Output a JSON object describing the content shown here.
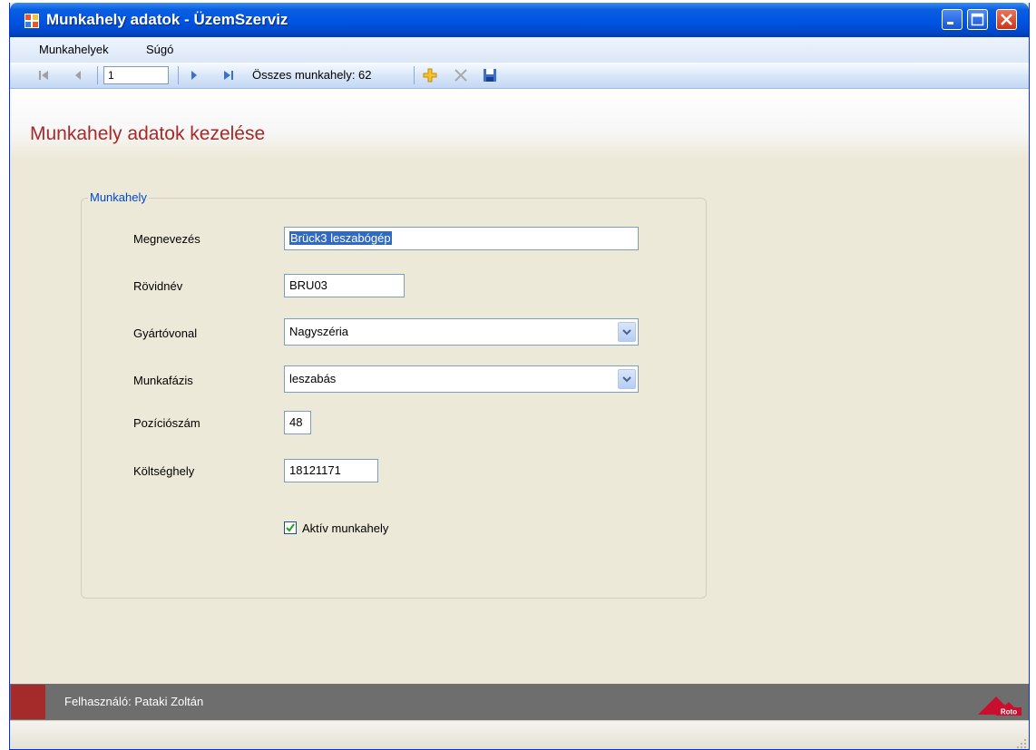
{
  "window": {
    "title": "Munkahely adatok - ÜzemSzerviz"
  },
  "menu": [
    {
      "label": "Munkahelyek"
    },
    {
      "label": "Súgó"
    }
  ],
  "toolbar": {
    "position_value": "1",
    "total_label": "Összes munkahely: 62",
    "icons": [
      "first-record-icon",
      "previous-record-icon",
      "next-record-icon",
      "last-record-icon",
      "add-icon",
      "delete-icon",
      "save-icon"
    ]
  },
  "header": {
    "title": "Munkahely adatok kezelése"
  },
  "form": {
    "group_label": "Munkahely",
    "fields": {
      "name": {
        "label": "Megnevezés",
        "value": "Brück3 leszabógép"
      },
      "short_name": {
        "label": "Rövidnév",
        "value": "BRU03"
      },
      "production_line": {
        "label": "Gyártóvonal",
        "value": "Nagyszéria"
      },
      "work_phase": {
        "label": "Munkafázis",
        "value": "leszabás"
      },
      "position_number": {
        "label": "Pozíciószám",
        "value": "48"
      },
      "cost_center": {
        "label": "Költséghely",
        "value": "18121171"
      }
    },
    "active": {
      "label": "Aktív munkahely",
      "checked": true
    }
  },
  "status": {
    "user_label": "Felhasználó: Pataki Zoltán",
    "logo_text": "Roto"
  },
  "colors": {
    "title_bar": "#0054E3",
    "header_title": "#A52A2A",
    "window_background": "#ECE9D8",
    "status_bar": "#6E6E6E",
    "accent_red": "#A52A2A"
  }
}
